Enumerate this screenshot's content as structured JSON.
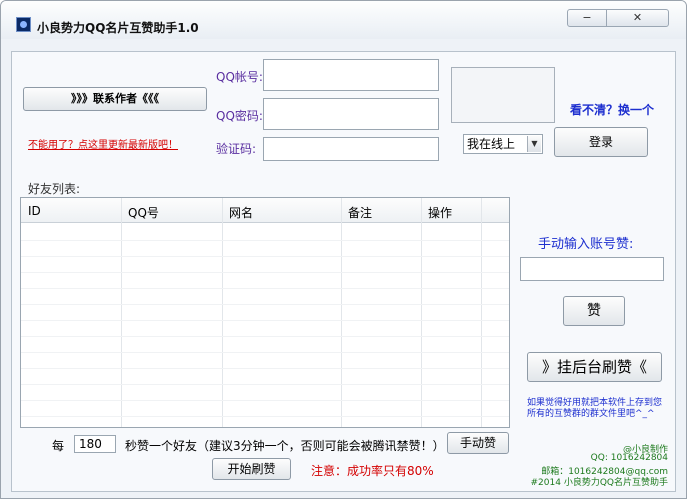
{
  "window": {
    "title": "小良势力QQ名片互赞助手1.0",
    "controls": {
      "minimize": "−",
      "restore": "▢",
      "close": "✕"
    }
  },
  "contact_author_button": "》》》联系作者《《《",
  "update_link": "不能用了？点这里更新最新版吧！",
  "login": {
    "qq_label": "QQ帐号:",
    "qq_value": "",
    "password_label": "QQ密码:",
    "password_value": "",
    "captcha_label": "验证码:",
    "captcha_value": "",
    "captcha_refresh": "看不清？换一个",
    "status_selected": "我在线上",
    "login_button": "登录"
  },
  "friends": {
    "label": "好友列表:",
    "columns": [
      "ID",
      "QQ号",
      "网名",
      "备注",
      "操作"
    ],
    "rows": []
  },
  "manual": {
    "label": "手动输入账号赞:",
    "input_value": "",
    "like_button": "赞",
    "background_button": "》挂后台刷赞《"
  },
  "share_note": "如果觉得好用就把本软件上存到您所有的互赞群的群文件里吧^_^",
  "timer": {
    "prefix": "每",
    "interval": "180",
    "suffix": "秒赞一个好友（建议3分钟一个，否则可能会被腾讯禁赞！）",
    "manual_button": "手动赞",
    "start_button": "开始刷赞",
    "notice": "注意：成功率只有80%"
  },
  "footer": {
    "line1": "@小良制作",
    "line2": "QQ: 1016242804",
    "line3": "邮箱：1016242804@qq.com",
    "line4": "#2014  小良势力QQ名片互赞助手"
  },
  "colors": {
    "label_purple": "#5a2fa0",
    "accent_blue": "#1d2fcf",
    "warning_red": "#d40000",
    "footer_green": "#1d7a1d"
  }
}
